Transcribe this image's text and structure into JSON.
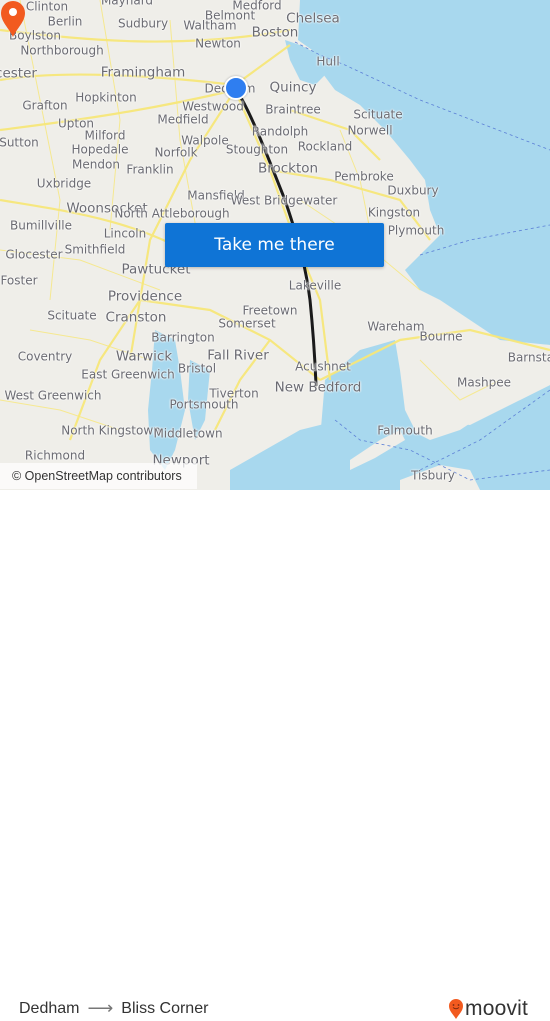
{
  "map": {
    "origin": "Dedham",
    "destination": "Bliss Corner",
    "attribution": "© OpenStreetMap contributors",
    "cta_label": "Take me there",
    "colors": {
      "land": "#efeee9",
      "water": "#a8d8ee",
      "roads": "#f7e77a",
      "route": "#1a1a1a",
      "origin_marker": "#2f7ef0",
      "destination_marker": "#f25a1f",
      "cta_background": "#0f74d6"
    },
    "places": [
      {
        "name": "Clinton"
      },
      {
        "name": "Maynard"
      },
      {
        "name": "Medford"
      },
      {
        "name": "Berlin"
      },
      {
        "name": "Sudbury"
      },
      {
        "name": "Belmont"
      },
      {
        "name": "Chelsea"
      },
      {
        "name": "Waltham"
      },
      {
        "name": "Boylston"
      },
      {
        "name": "Boston"
      },
      {
        "name": "Northborough"
      },
      {
        "name": "Newton"
      },
      {
        "name": "Hull"
      },
      {
        "name": "cester"
      },
      {
        "name": "Framingham"
      },
      {
        "name": "Dedham"
      },
      {
        "name": "Quincy"
      },
      {
        "name": "Hopkinton"
      },
      {
        "name": "Grafton"
      },
      {
        "name": "Westwood"
      },
      {
        "name": "Braintree"
      },
      {
        "name": "Upton"
      },
      {
        "name": "Medfield"
      },
      {
        "name": "Scituate"
      },
      {
        "name": "Milford"
      },
      {
        "name": "Randolph"
      },
      {
        "name": "Norwell"
      },
      {
        "name": "Sutton"
      },
      {
        "name": "Hopedale"
      },
      {
        "name": "Walpole"
      },
      {
        "name": "Norfolk"
      },
      {
        "name": "Stoughton"
      },
      {
        "name": "Rockland"
      },
      {
        "name": "Mendon"
      },
      {
        "name": "Franklin"
      },
      {
        "name": "Brockton"
      },
      {
        "name": "Uxbridge"
      },
      {
        "name": "Pembroke"
      },
      {
        "name": "Mansfield"
      },
      {
        "name": "Duxbury"
      },
      {
        "name": "West Bridgewater"
      },
      {
        "name": "Woonsocket"
      },
      {
        "name": "North Attleborough"
      },
      {
        "name": "Kingston"
      },
      {
        "name": "Bumillville"
      },
      {
        "name": "Lincoln"
      },
      {
        "name": "Plymouth"
      },
      {
        "name": "Glocester"
      },
      {
        "name": "Smithfield"
      },
      {
        "name": "Foster"
      },
      {
        "name": "Pawtucket"
      },
      {
        "name": "Lakeville"
      },
      {
        "name": "Providence"
      },
      {
        "name": "Scituate"
      },
      {
        "name": "Cranston"
      },
      {
        "name": "Freetown"
      },
      {
        "name": "Somerset"
      },
      {
        "name": "Wareham"
      },
      {
        "name": "Bourne"
      },
      {
        "name": "Barrington"
      },
      {
        "name": "Coventry"
      },
      {
        "name": "Warwick"
      },
      {
        "name": "Fall River"
      },
      {
        "name": "Barnstable"
      },
      {
        "name": "Acushnet"
      },
      {
        "name": "East Greenwich"
      },
      {
        "name": "Bristol"
      },
      {
        "name": "New Bedford"
      },
      {
        "name": "Mashpee"
      },
      {
        "name": "West Greenwich"
      },
      {
        "name": "Tiverton"
      },
      {
        "name": "Portsmouth"
      },
      {
        "name": "North Kingstown"
      },
      {
        "name": "Middletown"
      },
      {
        "name": "Falmouth"
      },
      {
        "name": "Richmond"
      },
      {
        "name": "Newport"
      },
      {
        "name": "Tisbury"
      }
    ]
  },
  "footer": {
    "origin": "Dedham",
    "destination": "Bliss Corner",
    "arrow": "⟶",
    "brand": "moovit"
  }
}
